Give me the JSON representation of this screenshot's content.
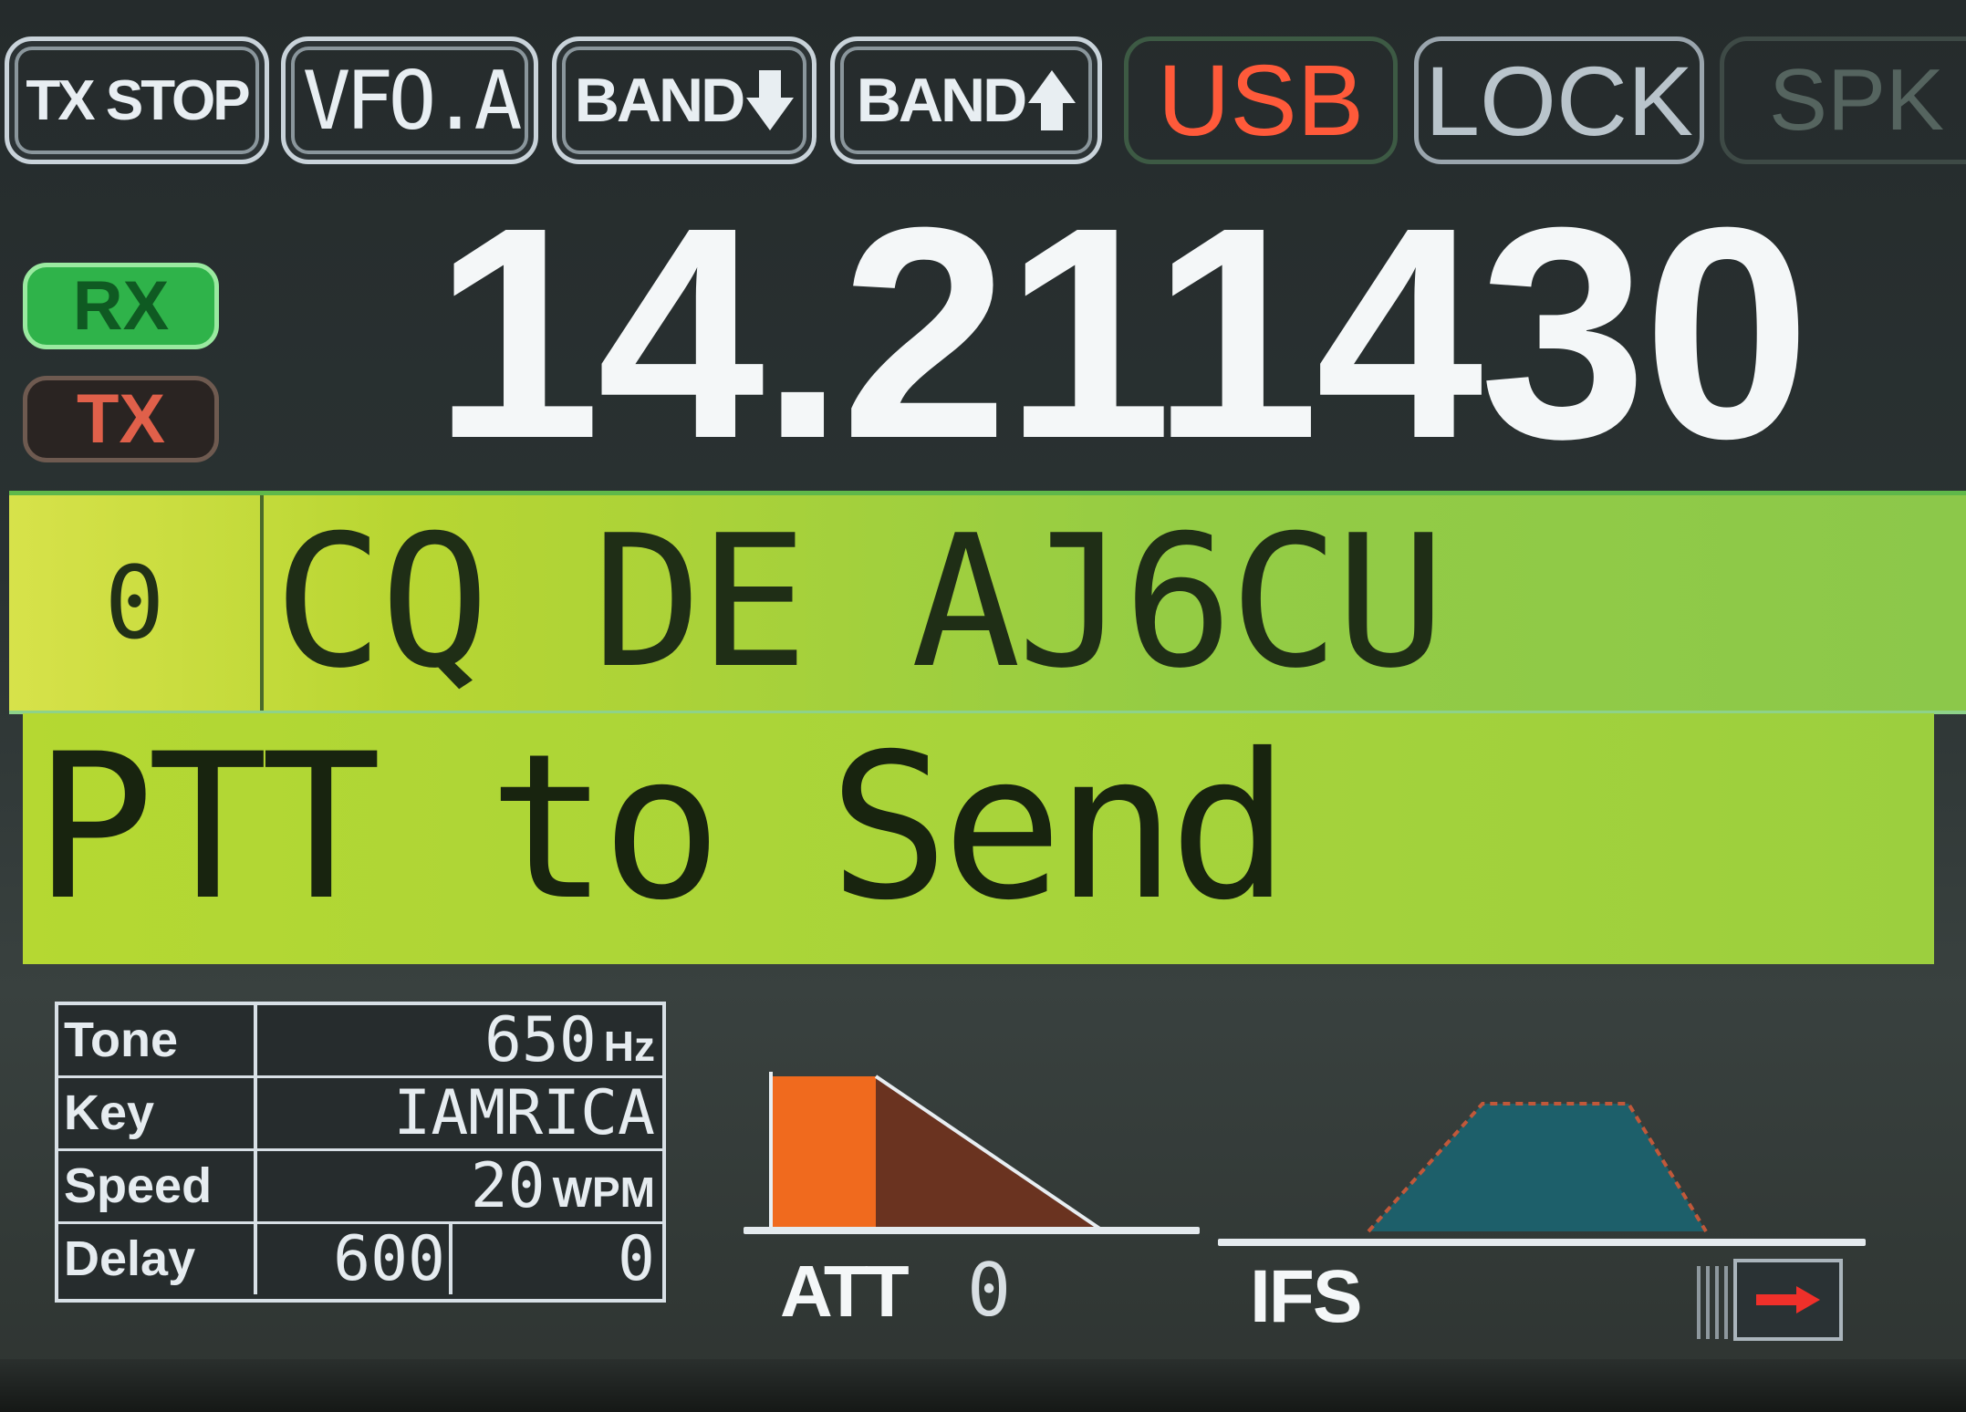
{
  "toolbar": {
    "tx_stop": "TX STOP",
    "vfo": "VFO.A",
    "band_down": "BAND",
    "band_up": "BAND",
    "mode": "USB",
    "lock": "LOCK",
    "spk": "SPK"
  },
  "indicators": {
    "rx": "RX",
    "tx": "TX"
  },
  "frequency": "14.211430",
  "cw_message": {
    "index": "0",
    "text": "CQ DE AJ6CU"
  },
  "status": "PTT to Send",
  "settings": {
    "tone_label": "Tone",
    "tone_value": "650",
    "tone_unit": "Hz",
    "key_label": "Key",
    "key_value": "IAMRICA",
    "speed_label": "Speed",
    "speed_value": "20",
    "speed_unit": "WPM",
    "delay_label": "Delay",
    "delay_value_1": "600",
    "delay_value_2": "0"
  },
  "filters": {
    "att_label": "ATT",
    "att_value": "0",
    "ifs_label": "IFS"
  },
  "colors": {
    "mode_text": "#ff5a3a",
    "rx_active": "#2fb34a",
    "tx_inactive": "#e0604a",
    "message_bg": "#94cc44",
    "att_fill": "#f06a1e",
    "ifs_fill": "#1d5f6a"
  },
  "icons": {
    "band_down": "arrow-down-icon",
    "band_up": "arrow-up-icon",
    "next": "arrow-right-icon"
  }
}
